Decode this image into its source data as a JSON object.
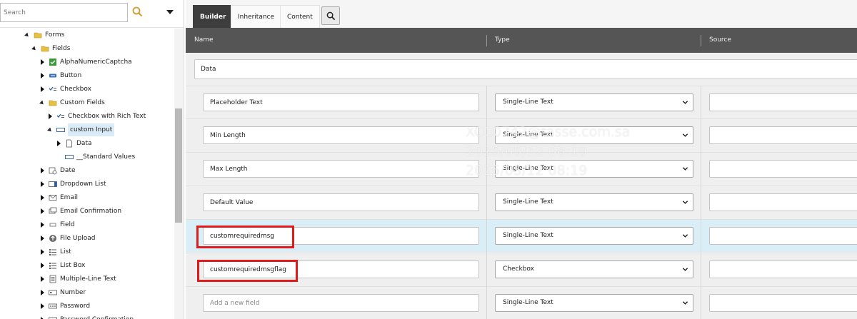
{
  "search": {
    "placeholder": "Search"
  },
  "tree": {
    "items": [
      {
        "label": "Forms",
        "icon": "folder-icon"
      },
      {
        "label": "Fields",
        "icon": "folder-icon"
      },
      {
        "label": "AlphaNumericCaptcha",
        "icon": "captcha-check-icon"
      },
      {
        "label": "Button",
        "icon": "button-icon"
      },
      {
        "label": "Checkbox",
        "icon": "checkbox-field-icon"
      },
      {
        "label": "Custom Fields",
        "icon": "folder-icon"
      },
      {
        "label": "Checkbox with Rich Text",
        "icon": "checkbox-field-icon"
      },
      {
        "label": "custom Input",
        "icon": "input-field-icon"
      },
      {
        "label": "Data",
        "icon": "document-icon"
      },
      {
        "label": "__Standard Values",
        "icon": "input-field-icon"
      },
      {
        "label": "Date",
        "icon": "date-field-icon"
      },
      {
        "label": "Dropdown List",
        "icon": "dropdown-field-icon"
      },
      {
        "label": "Email",
        "icon": "email-icon"
      },
      {
        "label": "Email Confirmation",
        "icon": "email-confirm-icon"
      },
      {
        "label": "Field",
        "icon": "field-icon"
      },
      {
        "label": "File Upload",
        "icon": "file-upload-icon"
      },
      {
        "label": "List",
        "icon": "list-icon"
      },
      {
        "label": "List Box",
        "icon": "list-icon"
      },
      {
        "label": "Multiple-Line Text",
        "icon": "multiline-text-icon"
      },
      {
        "label": "Number",
        "icon": "number-field-icon"
      },
      {
        "label": "Password",
        "icon": "password-field-icon"
      },
      {
        "label": "Password Confirmation",
        "icon": "password-field-icon"
      }
    ]
  },
  "tabs": [
    {
      "label": "Builder"
    },
    {
      "label": "Inheritance"
    },
    {
      "label": "Content"
    }
  ],
  "columns": {
    "name": "Name",
    "type": "Type",
    "source": "Source"
  },
  "section": {
    "name": "Data"
  },
  "fields": [
    {
      "name": "Placeholder Text",
      "type": "Single-Line Text"
    },
    {
      "name": "Min Length",
      "type": "Single-Line Text"
    },
    {
      "name": "Max Length",
      "type": "Single-Line Text"
    },
    {
      "name": "Default Value",
      "type": "Single-Line Text"
    },
    {
      "name": "customrequiredmsg",
      "type": "Single-Line Text"
    },
    {
      "name": "customrequiredmsgflag",
      "type": "Checkbox"
    }
  ],
  "new_field": {
    "placeholder": "Add a new field",
    "type": "Single-Line Text"
  },
  "watermark": {
    "line1": "XCC0742@tasse.com.sa",
    "line2": "2025/05/12 08:19",
    "line3": "2025/05/12 08:19"
  },
  "colors": {
    "header_bg": "#555555",
    "tab_active_bg": "#3d3d3d",
    "highlight_row": "#daeef8",
    "annotation_red": "#e01b1b",
    "folder_yellow": "#e8c040"
  }
}
